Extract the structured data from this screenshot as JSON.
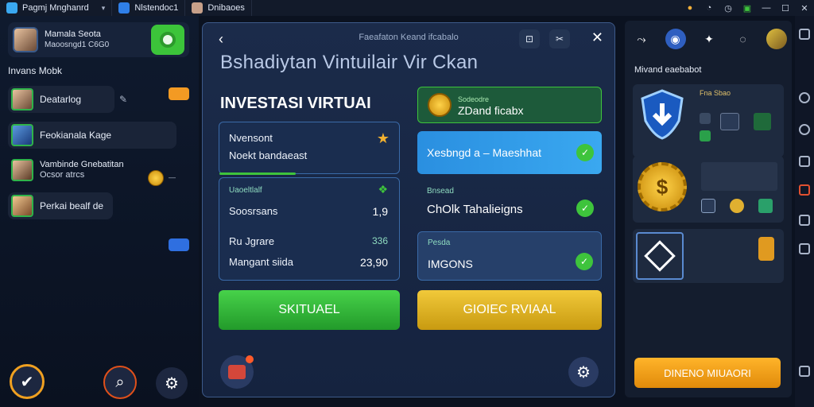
{
  "titlebar": {
    "tabs": [
      {
        "label": "Pagmj Mnghanrd"
      },
      {
        "label": "Nlstendoc1"
      },
      {
        "label": "Dnibaoes"
      }
    ]
  },
  "left": {
    "profile_name": "Mamala Seota",
    "profile_sub": "Maoosngd1 C6G0",
    "section_title": "Invans Mobk",
    "contacts": [
      {
        "label": "Deatarlog"
      },
      {
        "label": "Feokianala Kage"
      },
      {
        "line1": "Vambinde Gnebatitan",
        "line2": "Ocsor atrcs"
      },
      {
        "label": "Perkai bealf de"
      }
    ]
  },
  "main": {
    "top_title": "Faeafaton Keand ifcabalo",
    "headline": "Bshadiytan Vintuilair Vir Ckan",
    "subhead": "INVESTASI VIRTUAI",
    "card1": {
      "line1": "Nvensont",
      "line2": "Noekt bandaeast"
    },
    "card2": {
      "small": "Uaoeltlalf",
      "row1_label": "Soosrsans",
      "row1_value": "1,9",
      "row2_small": "Ru Jgrare",
      "row2_small_val": "336",
      "row2_label": "Mangant siida",
      "row2_value": "23,90"
    },
    "right_pill1": {
      "small": "Sodeodre",
      "label": "ZDand ficabx"
    },
    "right_pill2": {
      "label": "Xesbngd a – Maeshhat"
    },
    "right_item3": {
      "small": "Bnsead",
      "label": "ChOlk Tahalieigns"
    },
    "right_item4": {
      "small": "Pesda",
      "label": "IMGONS"
    },
    "btn_green": "SKITUAEL",
    "btn_yellow": "GIOIEC RVIAAL"
  },
  "right": {
    "title": "Mivand eaebabot",
    "box1_caption": "Fna Sbao",
    "btn_orange": "DINENO MIUAORI"
  }
}
